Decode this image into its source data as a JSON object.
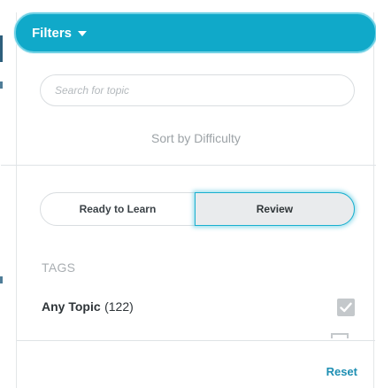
{
  "header": {
    "title": "Filters",
    "caret_icon": "chevron-down-icon"
  },
  "search": {
    "placeholder": "Search for topic",
    "value": ""
  },
  "sort": {
    "label": "Sort by Difficulty"
  },
  "toggle": {
    "left_label": "Ready to Learn",
    "right_label": "Review",
    "selected": "Review"
  },
  "tags": {
    "heading": "TAGS",
    "items": [
      {
        "label": "Any Topic",
        "count": "(122)",
        "checked": true
      }
    ]
  },
  "footer": {
    "reset_label": "Reset"
  },
  "colors": {
    "header_bg": "#10a9c9",
    "accent_link": "#1e8fb3",
    "selected_toggle_bg": "#e9ebed",
    "checkbox": "#c4c8cb"
  }
}
